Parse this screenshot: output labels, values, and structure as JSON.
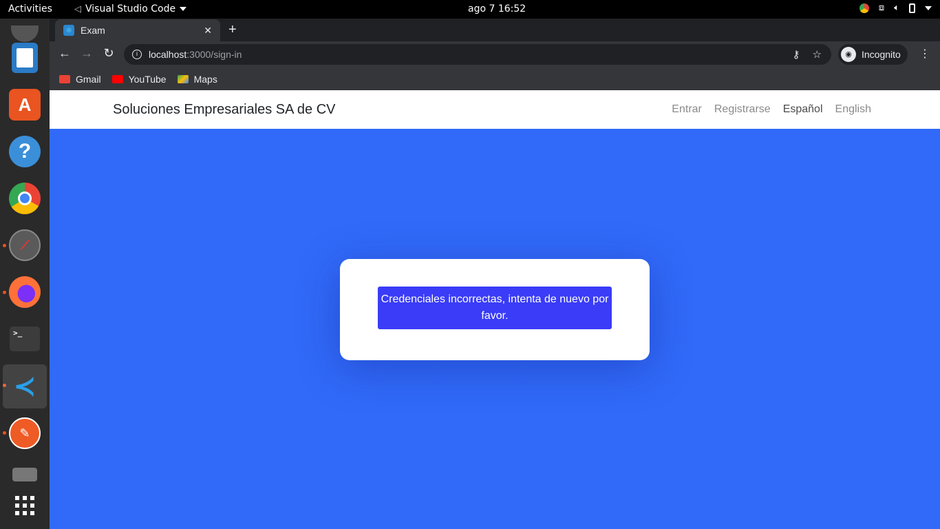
{
  "topbar": {
    "activities": "Activities",
    "app_name": "Visual Studio Code",
    "clock": "ago 7  16:52"
  },
  "dock": {
    "items": [
      "text-editor-icon",
      "software-center-icon",
      "help-icon",
      "chrome-icon",
      "clock-icon",
      "firefox-icon",
      "terminal-icon",
      "vscode-icon",
      "postman-icon",
      "files-icon",
      "app-grid-icon"
    ]
  },
  "browser": {
    "tab_title": "Exam",
    "url_host": "localhost",
    "url_path": ":3000/sign-in",
    "incognito_label": "Incognito",
    "bookmarks": [
      {
        "label": "Gmail",
        "color": "#ea4335"
      },
      {
        "label": "YouTube",
        "color": "#ff0000"
      },
      {
        "label": "Maps",
        "color": "#34a853"
      }
    ]
  },
  "page": {
    "brand": "Soluciones Empresariales SA de CV",
    "nav": {
      "entrar": "Entrar",
      "registrarse": "Registrarse",
      "espanol": "Español",
      "english": "English"
    },
    "alert_message": "Credenciales incorrectas, intenta de nuevo por favor.",
    "colors": {
      "background": "#316af8",
      "alert": "#3a3cf7"
    }
  }
}
